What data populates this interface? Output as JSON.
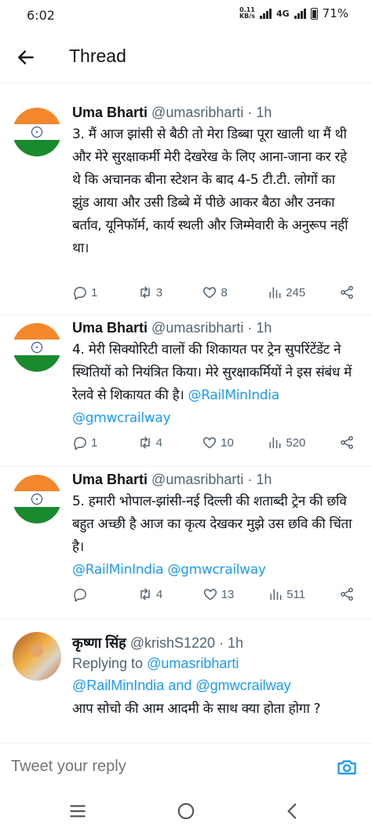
{
  "status_bar": {
    "time": "6:02",
    "net_speed_value": "0.11",
    "net_speed_unit": "KB/s",
    "network": "4G",
    "battery": "71%"
  },
  "header": {
    "title": "Thread"
  },
  "tweets": [
    {
      "name": "Uma Bharti",
      "handle": "@umasribharti",
      "time": "· 1h",
      "text": "3. मैं आज झांसी से बैठी तो मेरा डिब्बा पूरा खाली था मैं थी और मेरे सुरक्षाकर्मी मेरी देखरेख के लिए आना-जाना कर रहे थे कि अचानक बीना स्टेशन के बाद 4-5 टी.टी. लोगों का झुंड आया और उसी डिब्बे में पीछे आकर बैठा और उनका बर्ताव, यूनिफॉर्म, कार्य स्थली और जिम्मेवारी के अनुरूप नहीं था।",
      "replies": "1",
      "retweets": "3",
      "likes": "8",
      "views": "245"
    },
    {
      "name": "Uma Bharti",
      "handle": "@umasribharti",
      "time": "· 1h",
      "text": "4. मेरी सिक्योरिटी वालों की शिकायत पर ट्रेन सुपरिंटेंडेंट ने स्थितियों को नियंत्रित किया। मेरे सुरक्षाकर्मियों ने इस संबंध में रेलवे से शिकायत की है। ",
      "link1": "@RailMinIndia",
      "link2": "@gmwcrailway",
      "replies": "1",
      "retweets": "4",
      "likes": "10",
      "views": "520"
    },
    {
      "name": "Uma Bharti",
      "handle": "@umasribharti",
      "time": "· 1h",
      "text": "5. हमारी भोपाल-झांसी-नई दिल्ली की शताब्दी ट्रेन की छवि बहुत अच्छी है आज का कृत्य देखकर मुझे उस छवि की चिंता है।",
      "link1": "@RailMinIndia",
      "link2": "@gmwcrailway",
      "replies": "",
      "retweets": "4",
      "likes": "13",
      "views": "511"
    },
    {
      "name": "कृष्णा सिंह",
      "handle": "@krishS1220",
      "time": "· 1h",
      "replying_prefix": "Replying to ",
      "replying_to1": "@umasribharti",
      "replying_to2": "@RailMinIndia",
      "replying_and": " and ",
      "replying_to3": "@gmwcrailway",
      "text": "आप सोचो की आम आदमी के साथ क्या होता होगा ?"
    }
  ],
  "reply_bar": {
    "placeholder": "Tweet your reply"
  },
  "icons": {
    "back": "arrow-left-icon",
    "reply": "comment-icon",
    "retweet": "retweet-icon",
    "like": "heart-icon",
    "views": "bar-chart-icon",
    "share": "share-icon",
    "camera": "camera-icon",
    "nav_menu": "menu-icon",
    "nav_home": "home-circle-icon",
    "nav_back": "back-chevron-icon"
  },
  "colors": {
    "link": "#1d9bf0",
    "secondary": "#536471",
    "text": "#0f1419"
  }
}
